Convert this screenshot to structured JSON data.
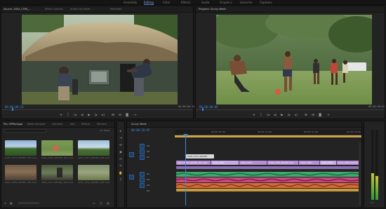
{
  "workspaces": [
    "Assembly",
    "Editing",
    "Color",
    "Effects",
    "Audio",
    "Graphics",
    "Libraries",
    "Captions"
  ],
  "workspace_active": "Editing",
  "source": {
    "tabs": [
      "Source: A002_C056_...",
      "Effect Controls",
      "Audio Clip Mixer: ...",
      "Metadata"
    ],
    "timecode": "00:00:00:10",
    "timecode_right": "00:00:00:15"
  },
  "program": {
    "tab": "Program: Sunny Week",
    "timecode": "00:00:00:06",
    "timecode_right": "00:00:00:02"
  },
  "project": {
    "tabs": [
      "Pro: HPPackage",
      "Media Browser",
      "Libraries",
      "Info",
      "Effects",
      "Markers"
    ],
    "count": "23 Items",
    "clips": [
      {
        "name": "A001_C003_0812BX_001.mp4",
        "dur": "5:00"
      },
      {
        "name": "A001_C006_0812BX_001.mp4",
        "dur": "5:07"
      },
      {
        "name": "A001_C007_0812BX_001.mp4",
        "dur": "5:18"
      },
      {
        "name": "A001_C008_0812BX_001.mp4",
        "dur": "4:12"
      },
      {
        "name": "A001_C011_0812BX_001.mp4",
        "dur": "6:02"
      },
      {
        "name": "A001_C012_0812BX_001.mp4",
        "dur": "3:20"
      }
    ]
  },
  "timeline": {
    "tab": "Sunny Week",
    "timecode": "00:00:28:05",
    "ruler": [
      "00:00:05:00",
      "00:00:10:00",
      "00:00:15:00",
      "00:00:20:00"
    ],
    "tracks": [
      "V3",
      "V2",
      "V1",
      "A1",
      "A2",
      "A3",
      "A4"
    ],
    "clips_v2": "A003_C012_0812BX",
    "clips_v1": [
      "A001_C003_0812BX_001.mp4",
      "A002_C056...",
      "A003_C034...",
      "A002_C076_0812BX.mp4",
      "A002_C056...",
      "A002_C056...",
      "A002_C056_0812BX.mp4"
    ]
  }
}
